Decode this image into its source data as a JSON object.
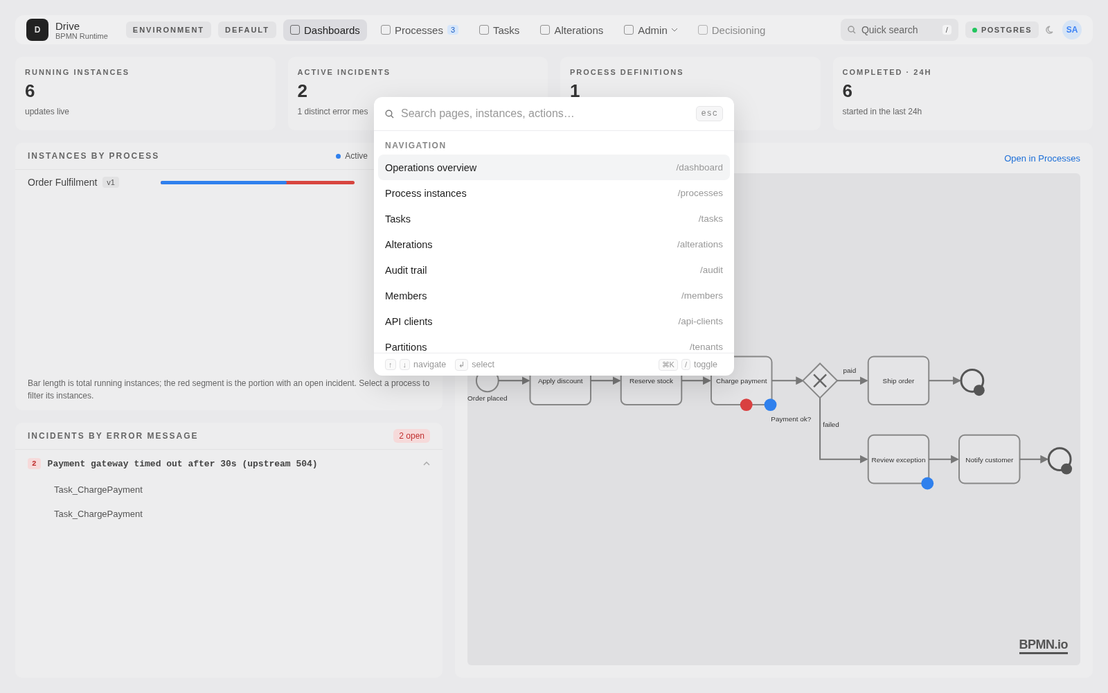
{
  "topbar": {
    "logo": "D",
    "app_name": "Drive",
    "app_subtitle": "BPMN Runtime",
    "pills": [
      "ENVIRONMENT",
      "DEFAULT"
    ],
    "tabs": [
      {
        "label": "Dashboards",
        "selected": true,
        "disabled": false
      },
      {
        "label": "Processes",
        "selected": false,
        "disabled": false,
        "badge": "3"
      },
      {
        "label": "Tasks",
        "selected": false,
        "disabled": false
      },
      {
        "label": "Alterations",
        "selected": false,
        "disabled": false
      },
      {
        "label": "Admin",
        "selected": false,
        "disabled": false,
        "dropdown": true
      },
      {
        "label": "Decisioning",
        "selected": false,
        "disabled": true
      }
    ],
    "search": {
      "placeholder": "Quick search",
      "shortcut": "/"
    },
    "database": {
      "label": "POSTGRES",
      "color": "#22c55e"
    },
    "avatar": "SA"
  },
  "stats": [
    {
      "label": "RUNNING INSTANCES",
      "value": "6",
      "note": "updates live"
    },
    {
      "label": "ACTIVE INCIDENTS",
      "value": "2",
      "note": "1 distinct error mes"
    },
    {
      "label": "PROCESS DEFINITIONS",
      "value": "1"
    },
    {
      "label": "COMPLETED · 24H",
      "value": "6",
      "note": "started in the last 24h"
    }
  ],
  "instances_panel": {
    "title": "INSTANCES BY PROCESS",
    "legend": "Active",
    "rows": [
      {
        "name": "Order Fulfilment",
        "version": "v1",
        "level": 0.65
      }
    ],
    "footnote": "Bar length is total running instances; the red segment is the portion with an open incident. Select a process to filter its instances."
  },
  "incidents_panel": {
    "title": "INCIDENTS BY ERROR MESSAGE",
    "badge": "2 open",
    "groups": [
      {
        "count": "2",
        "message": "Payment gateway timed out after 30s (upstream 504)",
        "expanded": true,
        "children": [
          {
            "task": "Task_ChargePayment"
          },
          {
            "task": "Task_ChargePayment"
          }
        ]
      }
    ]
  },
  "diagram_panel": {
    "link": "Open in Processes",
    "watermark": "BPMN.io",
    "labels": [
      "Order placed",
      "Apply discount",
      "Reserve stock",
      "Charge payment",
      "Payment ok?",
      "paid",
      "Ship order",
      "failed",
      "Review exception",
      "Notify customer"
    ]
  },
  "command_palette": {
    "placeholder": "Search pages, instances, actions…",
    "close_key": "esc",
    "section": "NAVIGATION",
    "items": [
      {
        "label": "Operations overview",
        "path": "/dashboard",
        "selected": true
      },
      {
        "label": "Process instances",
        "path": "/processes",
        "selected": false
      },
      {
        "label": "Tasks",
        "path": "/tasks",
        "selected": false
      },
      {
        "label": "Alterations",
        "path": "/alterations",
        "selected": false
      },
      {
        "label": "Audit trail",
        "path": "/audit",
        "selected": false
      },
      {
        "label": "Members",
        "path": "/members",
        "selected": false
      },
      {
        "label": "API clients",
        "path": "/api-clients",
        "selected": false
      },
      {
        "label": "Partitions",
        "path": "/tenants",
        "selected": false
      }
    ],
    "hints": [
      {
        "keys": [
          "↑",
          "↓"
        ],
        "label": "navigate"
      },
      {
        "keys": [
          "↲"
        ],
        "label": "select"
      },
      {
        "keys": [
          "⌘K",
          "/"
        ],
        "label": "toggle"
      }
    ]
  }
}
